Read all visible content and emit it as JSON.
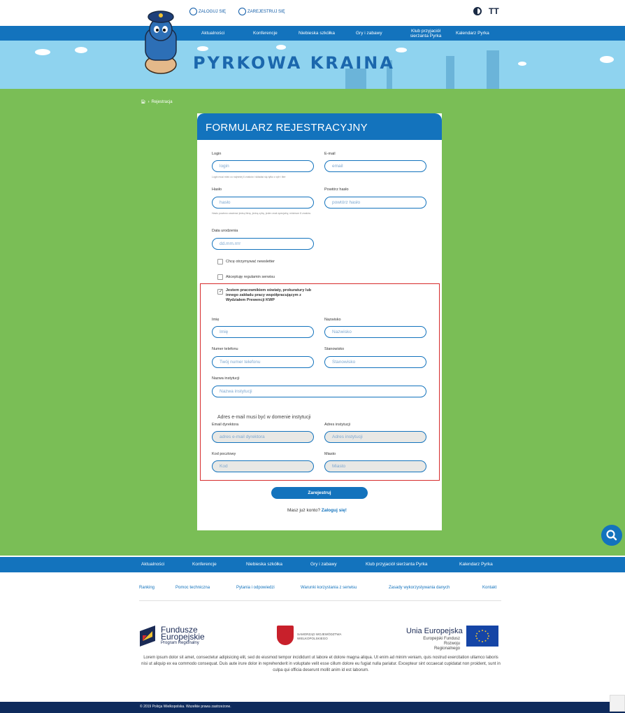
{
  "top": {
    "login": "ZALOGUJ SIĘ",
    "register": "ZAREJESTRUJ SIĘ",
    "font_size_icon": "TT"
  },
  "nav": {
    "items": [
      "Aktualności",
      "Konferencje",
      "Niebieska szkółka",
      "Gry i zabawy",
      "Klub przyjaciół sierżanta Pyrka",
      "Kalendarz Pyrka"
    ]
  },
  "banner": {
    "title": "PYRKOWA KRAINA"
  },
  "breadcrumb": {
    "current": "Rejestracja"
  },
  "form": {
    "title": "FORMULARZ REJESTRACYJNY",
    "login_label": "Login",
    "login_placeholder": "login",
    "login_hint": "Login musi mieć co najmniej 6 znaków i składać się tylko z cyfr i liter",
    "email_label": "E-mail",
    "email_placeholder": "email",
    "password_label": "Hasło",
    "password_placeholder": "hasło",
    "password_hint": "Hasło powinno zawierać jedną literę, jedną cyfrę, jeden znak specjalny, minimum 8 znaków.",
    "repeat_label": "Powtórz hasło",
    "repeat_placeholder": "powtórz hasło",
    "birth_label": "Data urodzenia",
    "birth_placeholder": "dd.mm.rrrr",
    "newsletter_label": "Chcę otrzymywać newsletter",
    "terms_label": "Akceptuję regulamin serwisu",
    "staff_label": "Jestem pracownikiem oświaty, prokuratury lub innego zakładu pracy współpracującym z Wydziałem Prewencji KWP",
    "staff_checked": true,
    "firstname_label": "Imię",
    "firstname_placeholder": "Imię",
    "lastname_label": "Nazwisko",
    "lastname_placeholder": "Nazwisko",
    "phone_label": "Numer telefonu",
    "phone_placeholder": "Twój numer telefonu",
    "position_label": "Stanowisko",
    "position_placeholder": "Stanowisko",
    "institution_label": "Nazwa instytucji",
    "institution_placeholder": "Nazwa instytucji",
    "domain_note": "Adres e-mail musi być w domenie instytucji",
    "director_label": "Email dyrektora",
    "director_placeholder": "adres e-mail dyrektora",
    "address_label": "Adres instytucji",
    "address_placeholder": "Adres instytucji",
    "postal_label": "Kod pocztowy",
    "postal_placeholder": "Kod",
    "city_label": "Miasto",
    "city_placeholder": "Miasto",
    "submit": "Zarejestruj",
    "have_account": "Masz już konto?",
    "login_link": "Zaloguj się!"
  },
  "footer": {
    "nav": [
      "Aktualności",
      "Konferencje",
      "Niebieska szkółka",
      "Gry i zabawy",
      "Klub przyjaciół sierżanta Pyrka",
      "Kalendarz Pyrka"
    ],
    "links": [
      "Ranking",
      "Pomoc techniczna",
      "Pytania i odpowiedzi",
      "Warunki korzystania z serwisu",
      "Zasady wykorzystywania danych",
      "Kontakt"
    ],
    "fe_title": "Fundusze Europejskie",
    "fe_sub": "Program Regionalny",
    "wlkp": "SAMORZĄD WOJEWÓDZTWA WIELKOPOLSKIEGO",
    "ue_title": "Unia Europejska",
    "ue_sub": "Europejski Fundusz Rozwoju Regionalnego",
    "lorem": "Lorem ipsum dolor sit amet, consectetur adipisicing elit, sed do eiusmod tempor incididunt ut labore et dolore magna aliqua. Ut enim ad minim veniam, quis nostrud exercitation ullamco laboris nisi ut aliquip ex ea commodo consequat. Duis aute irure dolor in reprehenderit in voluptate velit esse cillum dolore eu fugiat nulla pariatur. Excepteur sint occaecat cupidatat non proident, sunt in culpa qui officia deserunt mollit anim id est laborum.",
    "copyright": "© 2019 Policja Wielkopolska. Wszelkie prawa zastrzeżone."
  },
  "colors": {
    "blue": "#1373bd",
    "green": "#7abe56",
    "red_frame": "#d62b2b",
    "dark": "#0e2a5c"
  }
}
